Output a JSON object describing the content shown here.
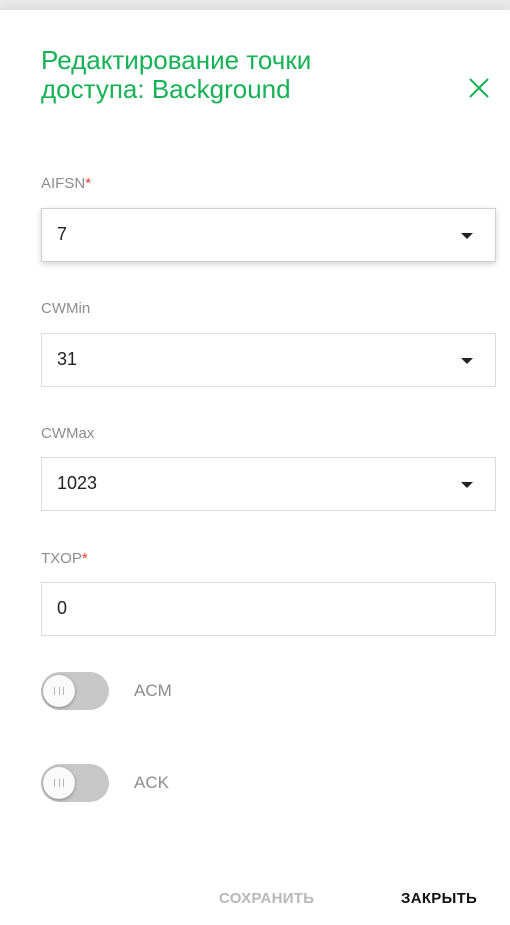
{
  "dialog": {
    "title": "Редактирование точки доступа: Background",
    "close_icon": "close-icon",
    "accent_color": "#16b255"
  },
  "fields": {
    "aifsn": {
      "label": "AIFSN",
      "required_mark": "*",
      "value": "7"
    },
    "cwmin": {
      "label": "CWMin",
      "value": "31"
    },
    "cwmax": {
      "label": "CWMax",
      "value": "1023"
    },
    "txop": {
      "label": "TXOP",
      "required_mark": "*",
      "value": "0"
    }
  },
  "toggles": {
    "acm": {
      "label": "ACM",
      "on": false
    },
    "ack": {
      "label": "ACK",
      "on": false
    }
  },
  "footer": {
    "save_label": "СОХРАНИТЬ",
    "close_label": "ЗАКРЫТЬ"
  }
}
